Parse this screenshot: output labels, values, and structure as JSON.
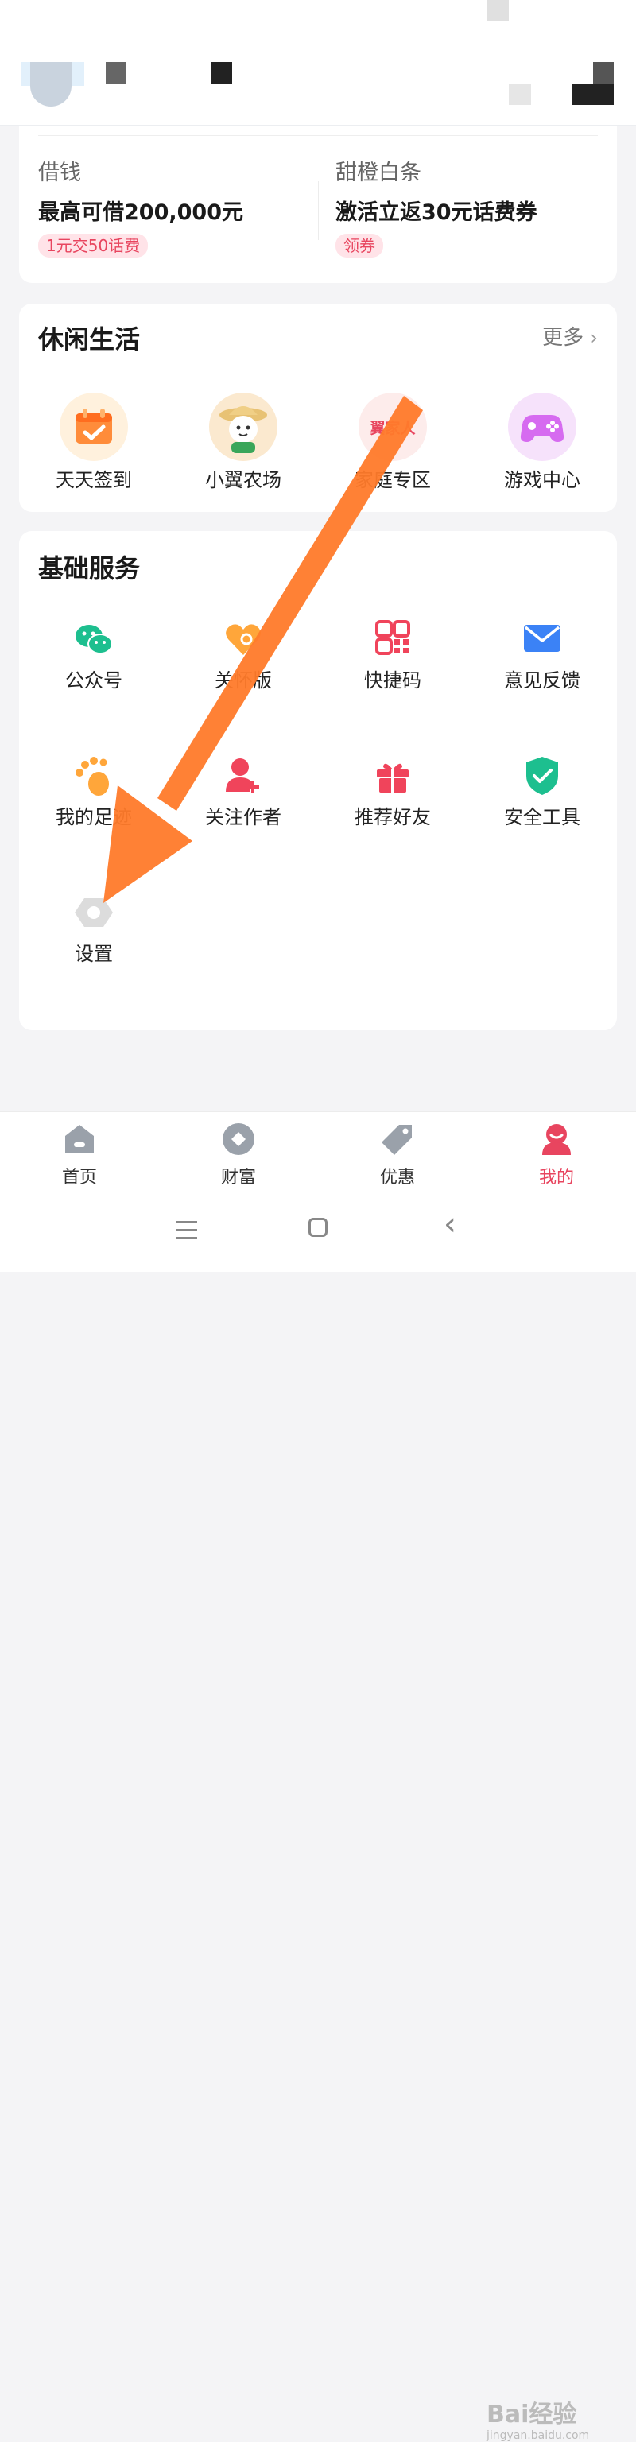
{
  "loan": {
    "left": {
      "title": "借钱",
      "headline": "最高可借200,000元",
      "tag": "1元交50话费"
    },
    "right": {
      "title": "甜橙白条",
      "headline": "激活立返30元话费券",
      "tag": "领券"
    }
  },
  "leisure": {
    "title": "休闲生活",
    "more": "更多",
    "items": [
      {
        "label": "天天签到",
        "icon": "calendar-check-icon"
      },
      {
        "label": "小翼农场",
        "icon": "farm-mascot-icon",
        "badge": ""
      },
      {
        "label": "家庭专区",
        "icon": "family-zone-icon",
        "badge": "翼家人"
      },
      {
        "label": "游戏中心",
        "icon": "gamepad-icon"
      }
    ]
  },
  "basic": {
    "title": "基础服务",
    "items": [
      {
        "label": "公众号",
        "icon": "wechat-icon"
      },
      {
        "label": "关怀版",
        "icon": "heart-icon"
      },
      {
        "label": "快捷码",
        "icon": "qr-code-icon"
      },
      {
        "label": "意见反馈",
        "icon": "mail-icon"
      },
      {
        "label": "我的足迹",
        "icon": "footprint-icon"
      },
      {
        "label": "关注作者",
        "icon": "follow-user-icon"
      },
      {
        "label": "推荐好友",
        "icon": "gift-icon"
      },
      {
        "label": "安全工具",
        "icon": "shield-check-icon"
      },
      {
        "label": "设置",
        "icon": "settings-icon"
      }
    ]
  },
  "tabbar": {
    "tabs": [
      {
        "label": "首页",
        "icon": "home-icon"
      },
      {
        "label": "财富",
        "icon": "wealth-icon"
      },
      {
        "label": "优惠",
        "icon": "tag-icon"
      },
      {
        "label": "我的",
        "icon": "profile-icon",
        "active": true
      }
    ]
  },
  "watermark": {
    "brand": "Bai经验",
    "url": "jingyan.baidu.com"
  },
  "colors": {
    "accent": "#e8455f",
    "arrow": "#ff7a2a",
    "green": "#1dbf8f",
    "blue": "#3b82f6"
  }
}
